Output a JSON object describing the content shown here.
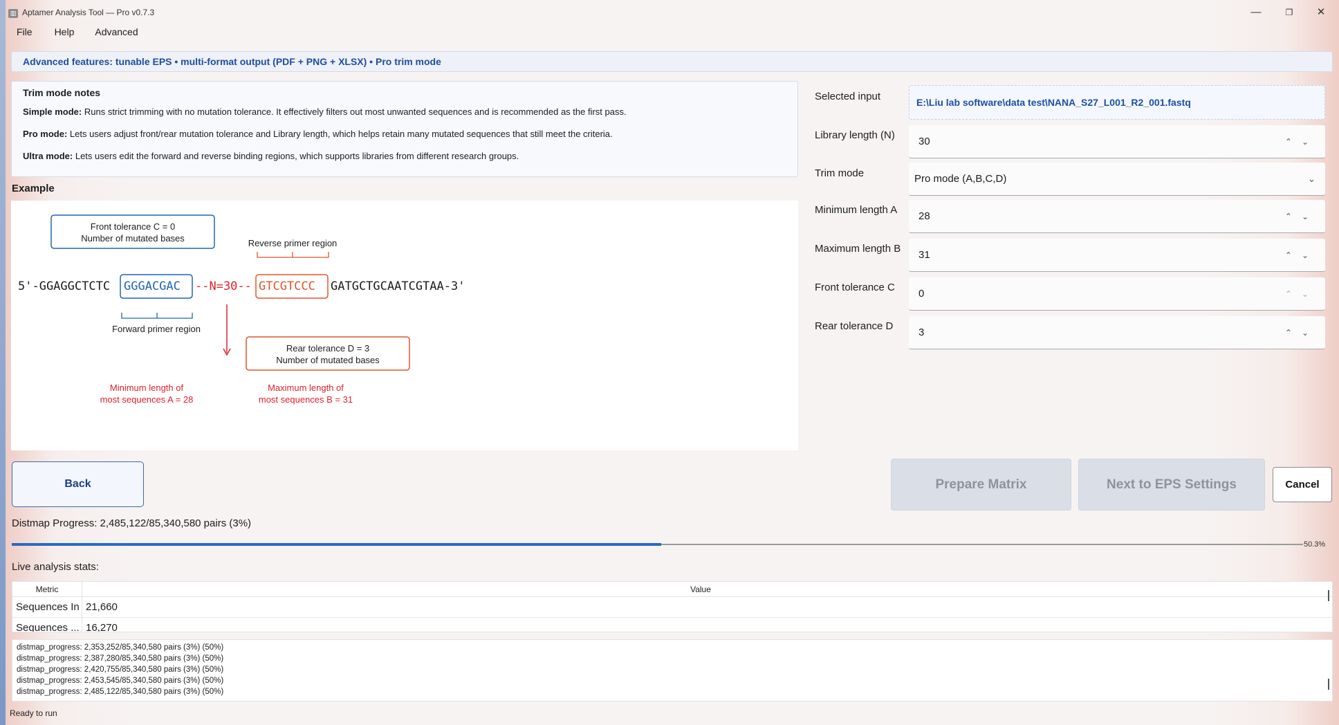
{
  "window": {
    "title": "Aptamer Analysis Tool — Pro v0.7.3",
    "minimize": "—",
    "maximize": "❐",
    "close": "✕"
  },
  "menu": [
    "File",
    "Help",
    "Advanced"
  ],
  "banner": "Advanced features: tunable EPS • multi-format output (PDF + PNG + XLSX) • Pro trim mode",
  "notes": {
    "title": "Trim mode notes",
    "items": [
      {
        "label": "Simple mode:",
        "text": " Runs strict trimming with no mutation tolerance. It effectively filters out most unwanted sequences and is recommended as the first pass."
      },
      {
        "label": "Pro mode:",
        "text": " Lets users adjust front/rear mutation tolerance and Library length, which helps retain many mutated sequences that still meet the criteria."
      },
      {
        "label": "Ultra mode:",
        "text": " Lets users edit the forward and reverse binding regions, which supports libraries from different research groups."
      }
    ]
  },
  "example": {
    "title": "Example",
    "front_tolerance_line1": "Front tolerance C = 0",
    "front_tolerance_line2": "Number of mutated bases",
    "reverse_primer_label": "Reverse primer region",
    "forward_primer_label": "Forward primer region",
    "seq_prefix": "5'-GGAGGCTCTC",
    "seq_forward": "GGGACGAC",
    "seq_middle": "--N=30--",
    "seq_reverse": "GTCGTCCC",
    "seq_suffix": "GATGCTGCAATCGTAA-3'",
    "rear_tolerance_line1": "Rear tolerance D = 3",
    "rear_tolerance_line2": "Number of mutated bases",
    "min_length_line1": "Minimum length of",
    "min_length_line2": "most sequences A = 28",
    "max_length_line1": "Maximum length of",
    "max_length_line2": "most sequences B = 31",
    "colors": {
      "blue": "#1f66b0",
      "orange": "#e0562a",
      "red": "#e0202a"
    }
  },
  "form": {
    "selected_input_label": "Selected input",
    "selected_input_value": "E:\\Liu lab software\\data test\\NANA_S27_L001_R2_001.fastq",
    "library_length_label": "Library length (N)",
    "library_length_value": "30",
    "trim_mode_label": "Trim mode",
    "trim_mode_value": "Pro mode (A,B,C,D)",
    "min_length_label": "Minimum length A",
    "min_length_value": "28",
    "max_length_label": "Maximum length B",
    "max_length_value": "31",
    "front_tol_label": "Front tolerance C",
    "front_tol_value": "0",
    "rear_tol_label": "Rear tolerance D",
    "rear_tol_value": "3",
    "spin_glyph": "⌃⌄",
    "chevron_glyph": "⌄"
  },
  "buttons": {
    "back": "Back",
    "prepare": "Prepare Matrix",
    "next": "Next to EPS Settings",
    "cancel": "Cancel"
  },
  "progress": {
    "text": "Distmap Progress: 2,485,122/85,340,580 pairs (3%)",
    "percent_label": "50.3%",
    "fraction": 0.503
  },
  "stats": {
    "label": "Live analysis stats:",
    "headers": [
      "Metric",
      "Value"
    ],
    "rows": [
      {
        "metric": "Sequences In",
        "value": "21,660"
      },
      {
        "metric": "Sequences ...",
        "value": "16,270"
      }
    ]
  },
  "log": [
    "distmap_progress: 2,353,252/85,340,580 pairs (3%) (50%)",
    "distmap_progress: 2,387,280/85,340,580 pairs (3%) (50%)",
    "distmap_progress: 2,420,755/85,340,580 pairs (3%) (50%)",
    "distmap_progress: 2,453,545/85,340,580 pairs (3%) (50%)",
    "distmap_progress: 2,485,122/85,340,580 pairs (3%) (50%)"
  ],
  "status": "Ready to run"
}
